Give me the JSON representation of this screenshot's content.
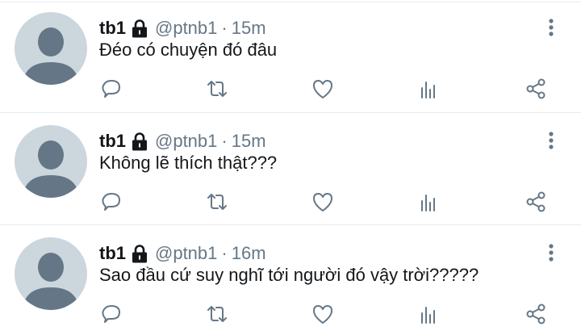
{
  "tweets": [
    {
      "name": "tb1",
      "handle": "@ptnb1",
      "separator": "·",
      "time": "15m",
      "text": "Đéo có chuyện đó đâu"
    },
    {
      "name": "tb1",
      "handle": "@ptnb1",
      "separator": "·",
      "time": "15m",
      "text": "Không lẽ thích thật???"
    },
    {
      "name": "tb1",
      "handle": "@ptnb1",
      "separator": "·",
      "time": "16m",
      "text": "Sao đầu cứ suy nghĩ tới người đó vậy trời?????"
    }
  ],
  "icons": {
    "protected": "lock-icon",
    "menu": "more-vertical-icon",
    "actions": [
      "reply-icon",
      "retweet-icon",
      "like-icon",
      "analytics-icon",
      "share-icon"
    ]
  },
  "colors": {
    "text_primary": "#14171a",
    "text_secondary": "#657786",
    "avatar_bg": "#ccd6dd",
    "avatar_silhouette": "#657786",
    "divider": "#e6ecf0"
  }
}
